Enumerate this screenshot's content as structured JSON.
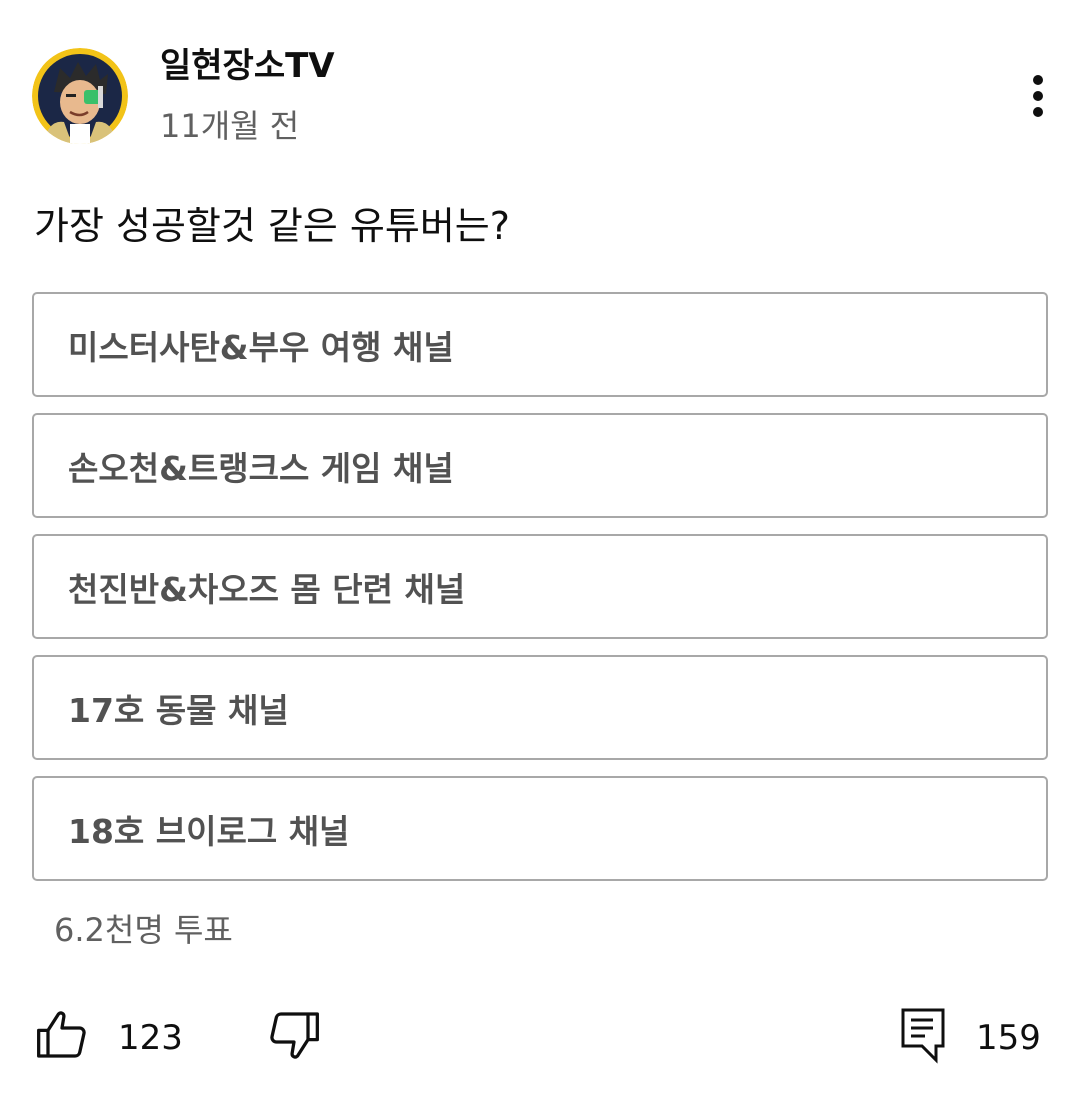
{
  "post": {
    "channel_name": "일현장소TV",
    "time": "11개월 전",
    "question": "가장 성공할것 같은 유튜버는?",
    "menu_icon": "more-vertical-icon",
    "avatar_icon": "channel-avatar-character"
  },
  "poll": {
    "options": [
      {
        "label": "미스터사탄&부우 여행 채널"
      },
      {
        "label": "손오천&트랭크스 게임 채널"
      },
      {
        "label": "천진반&차오즈 몸 단련 채널"
      },
      {
        "label": "17호 동물 채널"
      },
      {
        "label": "18호 브이로그 채널"
      }
    ],
    "vote_count": "6.2천명 투표"
  },
  "actions": {
    "like_count": "123",
    "comment_count": "159",
    "like_icon": "thumbs-up-icon",
    "dislike_icon": "thumbs-down-icon",
    "comment_icon": "comment-icon"
  },
  "colors": {
    "avatar_ring": "#f2c318",
    "avatar_bg": "#1b2746",
    "border": "#a8a8a8",
    "secondary_text": "#606060",
    "option_text": "#525252"
  }
}
